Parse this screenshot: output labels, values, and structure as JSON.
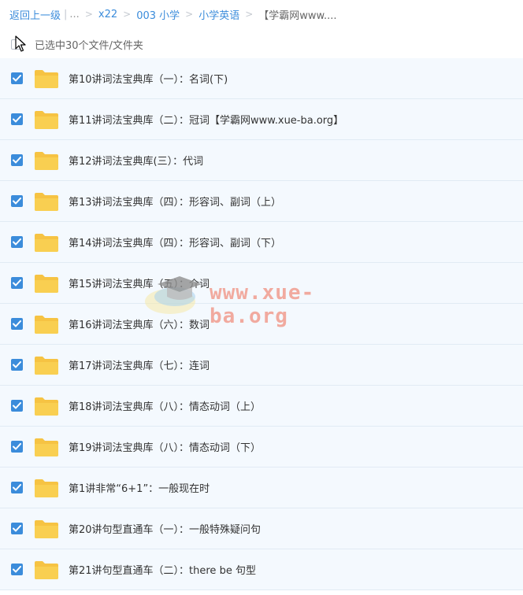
{
  "breadcrumb": {
    "back_label": "返回上一级",
    "ellipsis": "...",
    "items": [
      "x22",
      "003 小学",
      "小学英语"
    ],
    "current": "【学霸网www...."
  },
  "selection": {
    "text": "已选中30个文件/文件夹"
  },
  "files": [
    {
      "name": "第10讲词法宝典库（一）：名词(下)",
      "checked": true
    },
    {
      "name": "第11讲词法宝典库（二）：冠词【学霸网www.xue-ba.org】",
      "checked": true
    },
    {
      "name": "第12讲词法宝典库(三）：代词",
      "checked": true
    },
    {
      "name": "第13讲词法宝典库（四）：形容词、副词（上）",
      "checked": true
    },
    {
      "name": "第14讲词法宝典库（四）：形容词、副词（下）",
      "checked": true
    },
    {
      "name": "第15讲词法宝典库（五）：介词",
      "checked": true
    },
    {
      "name": "第16讲词法宝典库（六）：数词",
      "checked": true
    },
    {
      "name": "第17讲词法宝典库（七）：连词",
      "checked": true
    },
    {
      "name": "第18讲词法宝典库（八）：情态动词（上）",
      "checked": true
    },
    {
      "name": "第19讲词法宝典库（八）：情态动词（下）",
      "checked": true
    },
    {
      "name": "第1讲非常“6+1”：一般现在时",
      "checked": true
    },
    {
      "name": "第20讲句型直通车（一）：一般特殊疑问句",
      "checked": true
    },
    {
      "name": "第21讲句型直通车（二）：there be 句型",
      "checked": true
    }
  ],
  "watermark": {
    "text": "www.xue-ba.org"
  },
  "colors": {
    "accent": "#3b8cdb",
    "folder": "#f9cf51",
    "row_bg": "#f4f9fe"
  }
}
